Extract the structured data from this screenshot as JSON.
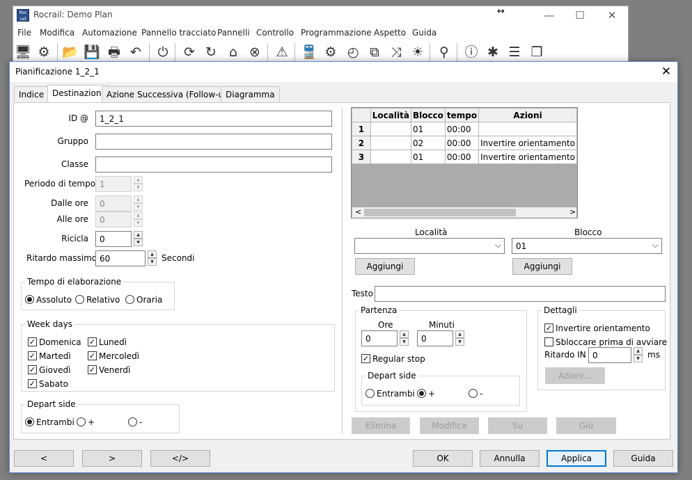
{
  "main_window": {
    "title": "Rocrail: Demo Plan",
    "controls": [
      "—",
      "☐",
      "✕"
    ],
    "resize_glyph": "↔",
    "menu": [
      "File",
      "Modifica",
      "Automazione",
      "Pannello tracciato",
      "Pannelli",
      "Controllo",
      "Programmazione",
      "Aspetto",
      "Guida"
    ],
    "toolbar_icons": [
      "computer-icon",
      "gears-icon",
      "folder-icon",
      "save-icon",
      "print-icon",
      "undo-icon",
      "power-icon",
      "refresh-icon",
      "rotate-icon",
      "home-icon",
      "stop-icon",
      "warning-icon",
      "train-icon",
      "loco-ops-icon",
      "clock-icon",
      "switchbox-icon",
      "shuffle-icon",
      "light-icon",
      "search-icon",
      "info-icon",
      "bug-icon",
      "list-icon",
      "copy-icon"
    ]
  },
  "dialog": {
    "title": "Pianificazione 1_2_1",
    "close_glyph": "✕",
    "tabs": [
      "Indice",
      "Destinazioni",
      "Azione Successiva (Follow-up)",
      "Diagramma"
    ],
    "active_tab": "Destinazioni"
  },
  "form": {
    "id_label": "ID @",
    "id_value": "1_2_1",
    "group_label": "Gruppo",
    "group_value": "",
    "class_label": "Classe",
    "class_value": "",
    "period_label": "Periodo di tempo",
    "period_value": "1",
    "from_label": "Dalle ore",
    "from_value": "0",
    "to_label": "Alle ore",
    "to_value": "0",
    "cycle_label": "Ricicla",
    "cycle_value": "0",
    "maxdelay_label": "Ritardo massimo",
    "maxdelay_value": "60",
    "seconds_label": "Secondi"
  },
  "time_processing": {
    "title": "Tempo di elaborazione",
    "options": [
      "Assoluto",
      "Relativo",
      "Oraria"
    ],
    "selected": "Assoluto"
  },
  "weekdays": {
    "title": "Week days",
    "col1": [
      "Domenica",
      "Martedì",
      "Giovedì",
      "Sabato"
    ],
    "col2": [
      "Lunedì",
      "Mercoledì",
      "Venerdì"
    ],
    "all_checked": true
  },
  "depart_side_left": {
    "title": "Depart side",
    "options": [
      "Entrambi",
      "+",
      "-"
    ],
    "selected": "Entrambi"
  },
  "grid": {
    "columns": [
      "",
      "Località",
      "Blocco",
      "tempo",
      "Azioni"
    ],
    "rows": [
      {
        "n": "1",
        "location": "",
        "block": "01",
        "time": "00:00",
        "actions": ""
      },
      {
        "n": "2",
        "location": "",
        "block": "02",
        "time": "00:00",
        "actions": "Invertire orientamento"
      },
      {
        "n": "3",
        "location": "",
        "block": "01",
        "time": "00:00",
        "actions": "Invertire orientamento"
      }
    ],
    "scroll_left": "<",
    "scroll_right": ">"
  },
  "selection": {
    "location_label": "Località",
    "location_value": "",
    "block_label": "Blocco",
    "block_value": "01",
    "add_label": "Aggiungi"
  },
  "text": {
    "label": "Testo",
    "value": ""
  },
  "departure": {
    "title": "Partenza",
    "hours_label": "Ore",
    "hours_value": "0",
    "minutes_label": "Minuti",
    "minutes_value": "0",
    "regular_stop_label": "Regular stop",
    "regular_stop_checked": true,
    "depart_side_title": "Depart side",
    "side_options": [
      "Entrambi",
      "+",
      "-"
    ],
    "side_selected": "+"
  },
  "details": {
    "title": "Dettagli",
    "reverse_label": "Invertire orientamento",
    "reverse_checked": true,
    "unlock_label": "Sbloccare prima di avviare",
    "unlock_checked": false,
    "delay_label": "Ritardo IN",
    "delay_value": "0",
    "delay_unit": "ms",
    "actions_label": "Azioni..."
  },
  "list_buttons": [
    "Elimina",
    "Modifica",
    "Su",
    "Giù"
  ],
  "footer": {
    "prev": "<",
    "next": ">",
    "xml": "</>",
    "ok": "OK",
    "cancel": "Annulla",
    "apply": "Applica",
    "help": "Guida"
  }
}
